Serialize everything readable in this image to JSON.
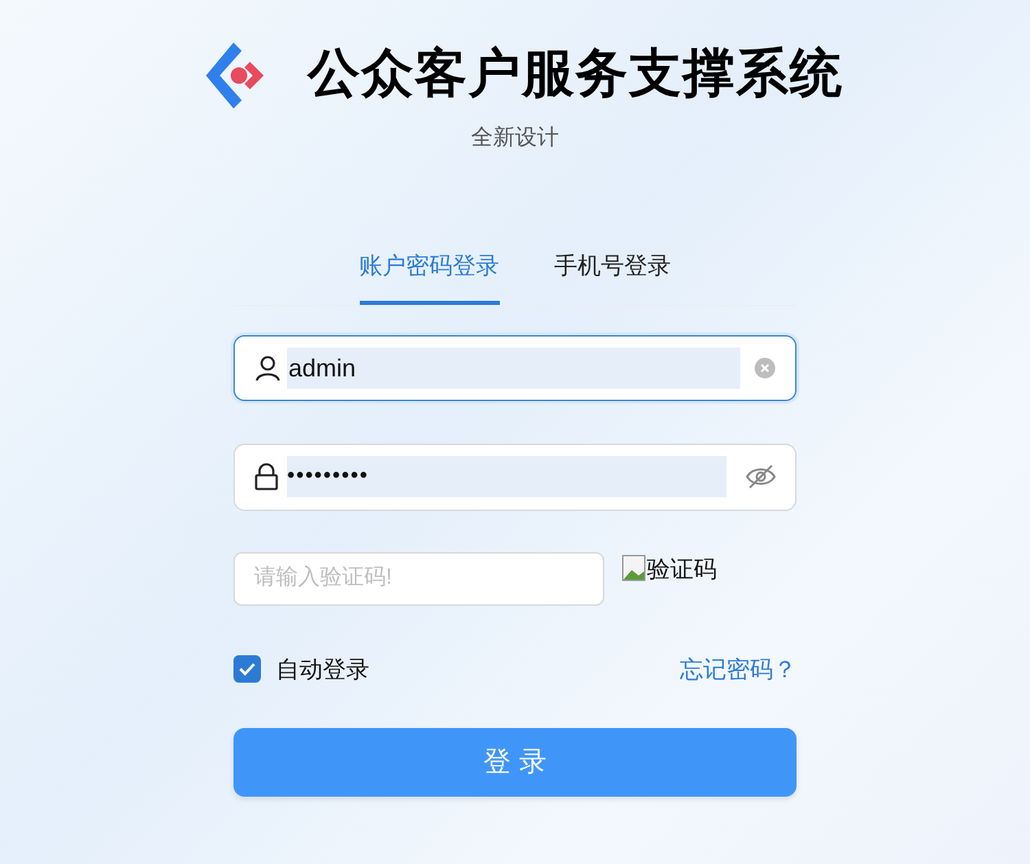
{
  "header": {
    "title": "公众客户服务支撑系统",
    "subtitle": "全新设计"
  },
  "tabs": [
    {
      "label": "账户密码登录",
      "selected": true
    },
    {
      "label": "手机号登录",
      "selected": false
    }
  ],
  "username": {
    "value": "admin",
    "focused": true
  },
  "password": {
    "value": "•••••••••"
  },
  "captcha": {
    "placeholder": "请输入验证码!",
    "image_alt": "验证码"
  },
  "auto_login": {
    "label": "自动登录",
    "checked": true
  },
  "forgot_link": "忘记密码？",
  "submit": "登 录"
}
